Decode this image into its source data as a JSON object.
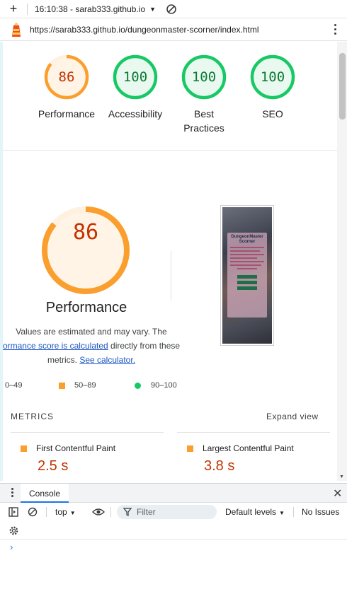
{
  "toolbar": {
    "target": "16:10:38 - sarab333.github.io",
    "icons": [
      "plus-icon",
      "chevron-down-icon",
      "block-icon"
    ]
  },
  "urlbar": {
    "url": "https://sarab333.github.io/dungeonmaster-scorner/index.html",
    "icons": [
      "lighthouse-icon",
      "kebab-menu-icon"
    ]
  },
  "gauges": [
    {
      "label": "Performance",
      "score": "86",
      "status": "average"
    },
    {
      "label": "Accessibility",
      "score": "100",
      "status": "pass"
    },
    {
      "label": "Best Practices",
      "score": "100",
      "status": "pass"
    },
    {
      "label": "SEO",
      "score": "100",
      "status": "pass"
    }
  ],
  "performance": {
    "score": "86",
    "title": "Performance",
    "note_part1": "Values are estimated and may vary. The",
    "note_link1": "ormance score is calculated",
    "note_part2": "directly from these",
    "note_part3": "metrics.",
    "note_link2": "See calculator."
  },
  "screenshot": {
    "app_title": "DungeonMaster Scorner"
  },
  "legend": {
    "fail": "0–49",
    "average": "50–89",
    "pass": "90–100"
  },
  "metrics": {
    "header": "METRICS",
    "expand_label": "Expand view",
    "items": [
      {
        "label": "First Contentful Paint",
        "value": "2.5 s"
      },
      {
        "label": "Largest Contentful Paint",
        "value": "3.8 s"
      }
    ]
  },
  "console": {
    "tab_label": "Console",
    "context": "top",
    "filter_placeholder": "Filter",
    "levels": "Default levels",
    "issues": "No Issues",
    "prompt": "›"
  },
  "colors": {
    "average": "#fa9f2e",
    "average_text": "#c33300",
    "pass": "#17c964",
    "pass_text": "#0a7b36",
    "link": "#1a55c0",
    "accent": "#1a73e8"
  }
}
